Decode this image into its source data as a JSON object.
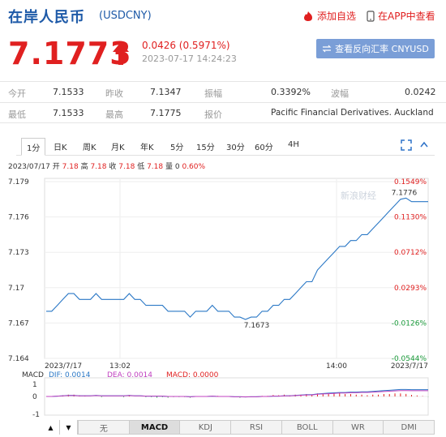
{
  "header": {
    "title": "在岸人民币",
    "code": "(USDCNY)",
    "add_fav": "添加自选",
    "app_view": "在APP中查看"
  },
  "quote": {
    "price": "7.1773",
    "change": "0.0426 (0.5971%)",
    "timestamp": "2023-07-17 14:24:23",
    "reverse_button": "查看反向汇率 CNYUSD"
  },
  "stats": {
    "row1": {
      "open_label": "今开",
      "open": "7.1533",
      "prev_label": "昨收",
      "prev": "7.1347",
      "amp_label": "振幅",
      "amp": "0.3392%",
      "vol_label": "波幅",
      "vol": "0.0242"
    },
    "row2": {
      "low_label": "最低",
      "low": "7.1533",
      "high_label": "最高",
      "high": "7.1775",
      "quote_label": "报价",
      "quote": "Pacific Financial Derivatives. Auckland"
    }
  },
  "tabs": [
    "1分",
    "日K",
    "周K",
    "月K",
    "年K",
    "5分",
    "15分",
    "30分",
    "60分",
    "4H"
  ],
  "ohlc": {
    "date": "2023/07/17",
    "open_label": "开",
    "open": "7.18",
    "high_label": "高",
    "high": "7.18",
    "close_label": "收",
    "close": "7.18",
    "low_label": "低",
    "low": "7.18",
    "qty": "量 0",
    "pct": "0.60%"
  },
  "watermark": "新浪财经",
  "chart_data": {
    "type": "line",
    "y_ticks": [
      "7.179",
      "7.176",
      "7.173",
      "7.17",
      "7.167",
      "7.164"
    ],
    "pct_ticks": [
      "0.1549%",
      "0.1130%",
      "0.0712%",
      "0.0293%",
      "-0.0126%",
      "-0.0544%"
    ],
    "x_labels": [
      "2023/7/17",
      "13:02",
      "14:00",
      "2023/7/17"
    ],
    "ylim": [
      7.164,
      7.179
    ],
    "annotations": {
      "max": "7.1776",
      "min": "7.1673"
    },
    "x": [
      0,
      2,
      4,
      6,
      8,
      10,
      12,
      14,
      16,
      18,
      20,
      22,
      24,
      26,
      28,
      30,
      32,
      34,
      36,
      38,
      40,
      42,
      44,
      46,
      48,
      50,
      52,
      54,
      56,
      58,
      60,
      62,
      64,
      66,
      68,
      70,
      72,
      74,
      76,
      78,
      80,
      82,
      84,
      86,
      88,
      90,
      92,
      94,
      96,
      98,
      100,
      102,
      104,
      106,
      108,
      110,
      112,
      114,
      116,
      118,
      120,
      122,
      124,
      126,
      128,
      130,
      132,
      134,
      136,
      138,
      140,
      142,
      144,
      146,
      148,
      150,
      152,
      154,
      156,
      158,
      160,
      162,
      164,
      166,
      168,
      170,
      172,
      174,
      176,
      178,
      180,
      182,
      184,
      186,
      188,
      190,
      192,
      194,
      196,
      198,
      200,
      202,
      204,
      206,
      208,
      210,
      212,
      214,
      216,
      218,
      220,
      222,
      224,
      226,
      228,
      230,
      232,
      234,
      236,
      238
    ],
    "values": [
      7.168,
      7.168,
      7.1685,
      7.169,
      7.1695,
      7.1695,
      7.169,
      7.169,
      7.169,
      7.1695,
      7.169,
      7.169,
      7.169,
      7.169,
      7.169,
      7.1695,
      7.169,
      7.169,
      7.1685,
      7.1685,
      7.1685,
      7.1685,
      7.168,
      7.168,
      7.168,
      7.168,
      7.1675,
      7.168,
      7.168,
      7.168,
      7.1685,
      7.168,
      7.168,
      7.168,
      7.1675,
      7.1675,
      7.1673,
      7.1675,
      7.1675,
      7.168,
      7.168,
      7.1685,
      7.1685,
      7.169,
      7.169,
      7.1695,
      7.17,
      7.1705,
      7.1705,
      7.1715,
      7.172,
      7.1725,
      7.173,
      7.1735,
      7.1735,
      7.174,
      7.174,
      7.1745,
      7.1745,
      7.175,
      7.1755,
      7.176,
      7.1765,
      7.177,
      7.1775,
      7.1776,
      7.1773,
      7.1773,
      7.1773,
      7.1773
    ],
    "macd": {
      "dif_label": "DIF",
      "dif": "0.0014",
      "dea_label": "DEA",
      "dea": "0.0014",
      "macd_label": "MACD",
      "macd": "0.0000",
      "y_ticks": [
        "1",
        "0",
        "-1"
      ]
    }
  },
  "bottom_tabs": [
    "无",
    "MACD",
    "KDJ",
    "RSI",
    "BOLL",
    "WR",
    "DMI"
  ],
  "colors": {
    "brand": "#1e5aa8",
    "up": "#e02020",
    "down": "#1a9a3a",
    "line": "#2b78c6",
    "macd_dea": "#c040c0"
  }
}
